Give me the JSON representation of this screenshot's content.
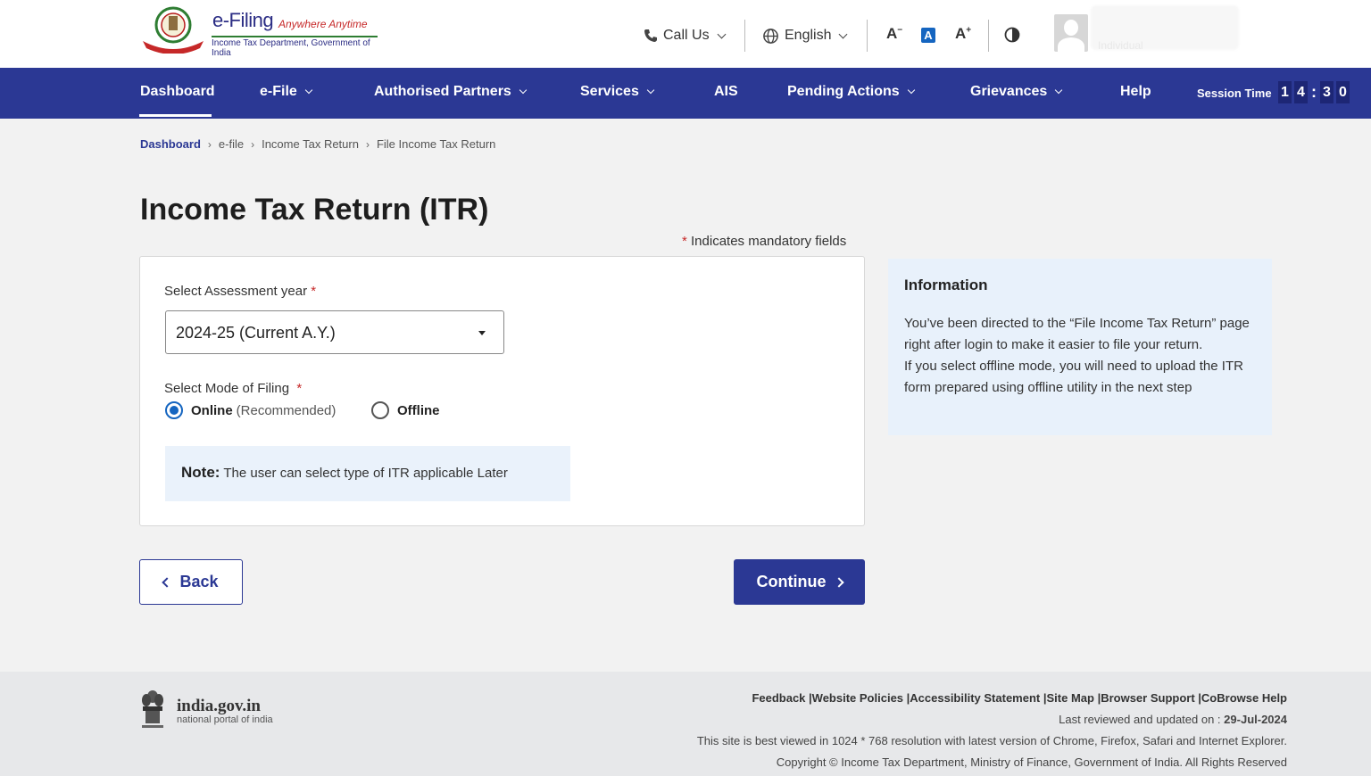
{
  "header": {
    "logo_title": "e-Filing",
    "logo_tagline": "Anywhere Anytime",
    "logo_department": "Income Tax Department, Government of India",
    "call_us": "Call Us",
    "language": "English",
    "font_decrease": "A",
    "font_normal": "A",
    "font_increase": "A",
    "user_type": "Individual"
  },
  "nav": {
    "items": [
      {
        "label": "Dashboard"
      },
      {
        "label": "e-File"
      },
      {
        "label": "Authorised Partners"
      },
      {
        "label": "Services"
      },
      {
        "label": "AIS"
      },
      {
        "label": "Pending Actions"
      },
      {
        "label": "Grievances"
      },
      {
        "label": "Help"
      }
    ],
    "session_label": "Session Time",
    "session_digits": [
      "1",
      "4",
      "3",
      "0"
    ],
    "session_colon": ":"
  },
  "breadcrumb": [
    "Dashboard",
    "e-file",
    "Income Tax Return",
    "File Income Tax Return"
  ],
  "page": {
    "title": "Income Tax Return (ITR)",
    "mandatory_star": "*",
    "mandatory_text": "Indicates mandatory fields"
  },
  "form": {
    "assessment_label": "Select Assessment year",
    "assessment_value": "2024-25 (Current A.Y.)",
    "mode_label": "Select Mode of Filing",
    "online_label": "Online",
    "online_sub": "(Recommended)",
    "offline_label": "Offline",
    "selected_mode": "Online",
    "note_label": "Note:",
    "note_text": "The user can select type of ITR applicable Later"
  },
  "info": {
    "title": "Information",
    "line1": "You’ve been directed to the “File Income Tax Return” page right after login to make it easier to file your return.",
    "line2": "If you select offline mode, you will need to upload the ITR form prepared using offline utility in the next step"
  },
  "buttons": {
    "back": "Back",
    "continue": "Continue"
  },
  "footer": {
    "gov_title": "india.gov.in",
    "gov_subtitle": "national portal of india",
    "links": [
      "Feedback",
      "Website Policies",
      "Accessibility Statement",
      "Site Map",
      "Browser Support",
      "CoBrowse Help"
    ],
    "reviewed_label": "Last reviewed and updated on :",
    "reviewed_date": "29-Jul-2024",
    "best_viewed": "This site is best viewed in 1024 * 768 resolution with latest version of Chrome, Firefox, Safari and Internet Explorer.",
    "copyright": "Copyright © Income Tax Department, Ministry of Finance, Government of India. All Rights Reserved"
  },
  "colors": {
    "nav_bg": "#2b3894",
    "accent_blue": "#1565c0",
    "required_red": "#c62828",
    "info_bg": "#e8f1fb"
  }
}
